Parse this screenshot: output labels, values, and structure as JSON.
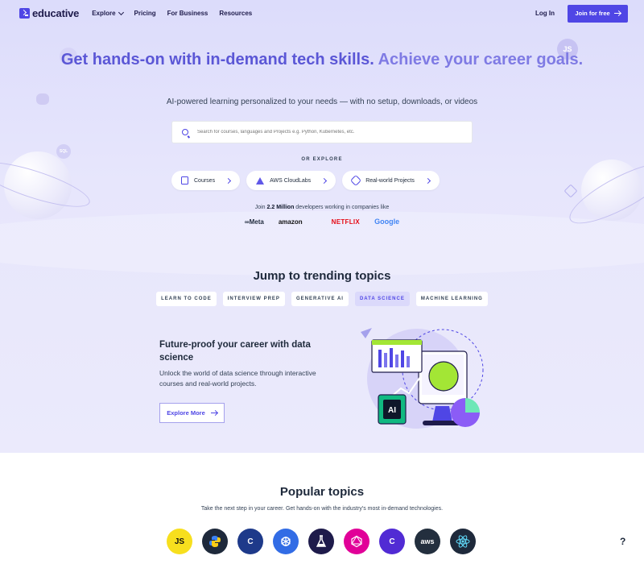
{
  "brand": {
    "name": "educative",
    "accent": "#4f46e5"
  },
  "nav": {
    "links": [
      "Explore",
      "Pricing",
      "For Business",
      "Resources"
    ],
    "login": "Log In",
    "join": "Join for free"
  },
  "hero": {
    "title_main": "Get hands-on with in-demand tech skills.",
    "title_alt": " Achieve your career goals.",
    "subtitle": "AI-powered learning personalized to your needs — with no setup, downloads, or videos",
    "search_placeholder": "Search for courses, languages and Projects e.g. Python, Kubernetes, etc.",
    "or_explore": "OR EXPLORE",
    "pills": [
      "Courses",
      "AWS CloudLabs",
      "Real-world Projects"
    ],
    "join_prefix": "Join ",
    "join_count": "2.2 Million",
    "join_suffix": " developers working in companies like",
    "companies": [
      "∞Meta",
      "amazon",
      "",
      "NETFLIX",
      "Google"
    ],
    "badges": {
      "js": "JS",
      "sql": "SQL"
    }
  },
  "trending": {
    "title": "Jump to trending topics",
    "tabs": [
      "LEARN TO CODE",
      "INTERVIEW PREP",
      "GENERATIVE AI",
      "DATA SCIENCE",
      "MACHINE LEARNING"
    ],
    "active_tab": "DATA SCIENCE",
    "feature_title": "Future-proof your career with data science",
    "feature_desc": "Unlock the world of data science through interactive courses and real-world projects.",
    "explore_label": "Explore More",
    "chip_label": "AI"
  },
  "popular": {
    "title": "Popular topics",
    "subtitle": "Take the next step in your career. Get hands-on with the industry's most in-demand technologies.",
    "topics": [
      {
        "icon": "javascript-icon",
        "label": "JS",
        "color": "#f7df1e",
        "text": "#111111"
      },
      {
        "icon": "python-icon",
        "label": "",
        "color": "#1e293b",
        "text": "#ffffff"
      },
      {
        "icon": "c-plus-plus-icon",
        "label": "C",
        "color": "#1e3a8a",
        "text": "#ffffff"
      },
      {
        "icon": "kubernetes-icon",
        "label": "",
        "color": "#326ce5",
        "text": "#ffffff"
      },
      {
        "icon": "flask-icon",
        "label": "",
        "color": "#1e1b4b",
        "text": "#ffffff"
      },
      {
        "icon": "graphql-icon",
        "label": "",
        "color": "#e10098",
        "text": "#ffffff"
      },
      {
        "icon": "csharp-icon",
        "label": "C",
        "color": "#512bd4",
        "text": "#ffffff"
      },
      {
        "icon": "aws-icon",
        "label": "aws",
        "color": "#232f3e",
        "text": "#ffffff"
      },
      {
        "icon": "react-icon",
        "label": "",
        "color": "#1e293b",
        "text": "#61dafb"
      }
    ],
    "help": "?"
  }
}
